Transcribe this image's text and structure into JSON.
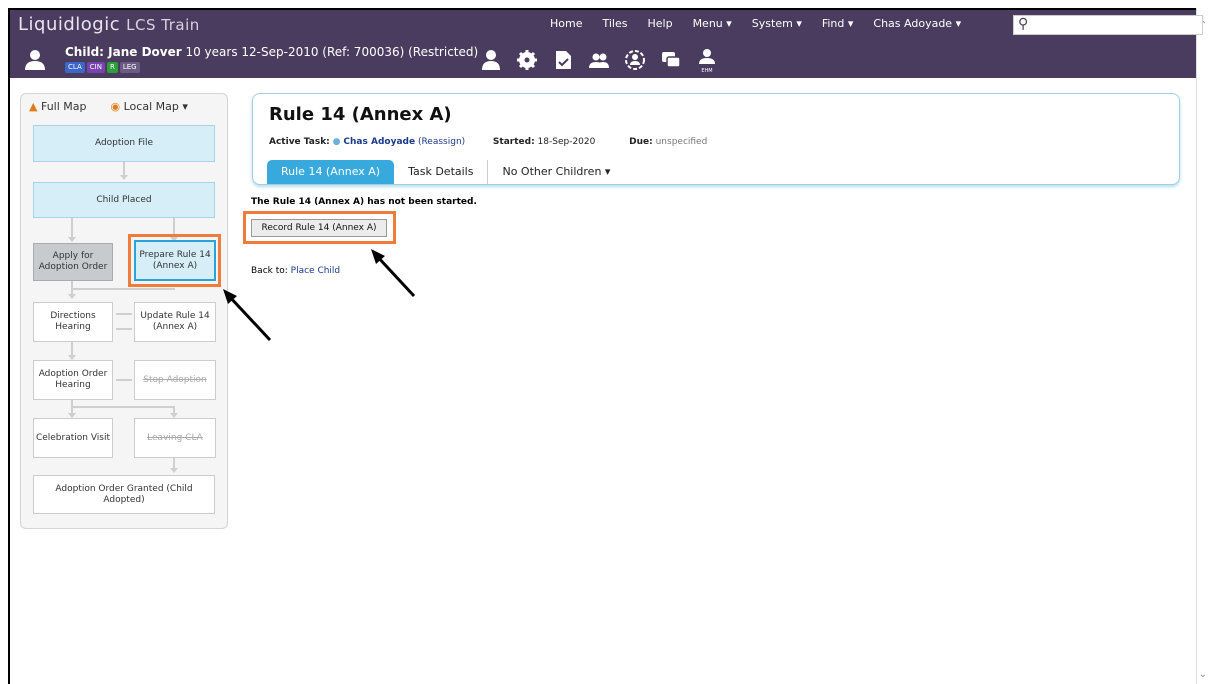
{
  "app": {
    "brand": "Liquidlogic",
    "env": "LCS Train"
  },
  "topnav": {
    "items": [
      "Home",
      "Tiles",
      "Help",
      "Menu ▾",
      "System ▾",
      "Find ▾",
      "Chas Adoyade ▾"
    ],
    "search_placeholder": ""
  },
  "child": {
    "label_prefix": "Child: Jane Dover",
    "details": " 10 years 12-Sep-2010 (Ref: 700036) (Restricted)",
    "tags": [
      "CLA",
      "CIN",
      "R",
      "LEG"
    ],
    "ehm_label": "EHM"
  },
  "leftpanel": {
    "full_map": "Full Map",
    "local_map": "Local Map ▾",
    "nodes": {
      "adoption_file": "Adoption File",
      "child_placed": "Child Placed",
      "apply_order": "Apply for Adoption Order",
      "prepare_rule14": "Prepare Rule 14 (Annex A)",
      "directions_hearing": "Directions Hearing",
      "update_rule14": "Update Rule 14 (Annex A)",
      "adoption_order_hearing": "Adoption Order Hearing",
      "stop_adoption": "Stop Adoption",
      "celebration_visit": "Celebration Visit",
      "leaving_cla": "Leaving CLA",
      "order_granted": "Adoption Order Granted (Child Adopted)"
    }
  },
  "card": {
    "title": "Rule 14 (Annex A)",
    "active_task_label": "Active Task:",
    "active_task_user": "Chas Adoyade",
    "reassign": "(Reassign)",
    "started_label": "Started:",
    "started_value": "18-Sep-2020",
    "due_label": "Due:",
    "due_value": "unspecified",
    "tabs": [
      "Rule 14 (Annex A)",
      "Task Details",
      "No Other Children ▾"
    ]
  },
  "main": {
    "status": "The Rule 14 (Annex A) has not been started.",
    "record_button": "Record Rule 14 (Annex A)",
    "back_prefix": "Back to:",
    "back_link": "Place Child"
  },
  "colors": {
    "topbar": "#4a3c5e",
    "accent": "#38a9dc",
    "highlight": "#f07b3a",
    "link": "#1a3a8c"
  }
}
